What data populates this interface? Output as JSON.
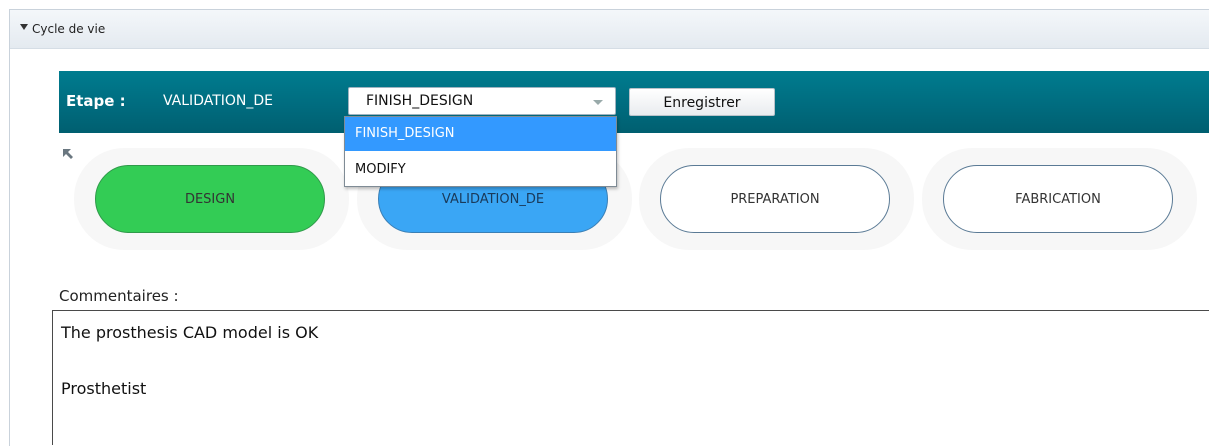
{
  "panel": {
    "title": "Cycle de vie"
  },
  "stepbar": {
    "label": "Etape :",
    "current": "VALIDATION_DE",
    "select_value": "FINISH_DESIGN",
    "options": [
      "FINISH_DESIGN",
      "MODIFY"
    ],
    "save_label": "Enregistrer"
  },
  "steps": [
    {
      "label": "DESIGN",
      "state": "done",
      "color": "#33cc55"
    },
    {
      "label": "VALIDATION_DE",
      "state": "current",
      "color": "#3aa6f5"
    },
    {
      "label": "PREPARATION",
      "state": "pending",
      "color": "#ffffff"
    },
    {
      "label": "FABRICATION",
      "state": "pending",
      "color": "#ffffff"
    }
  ],
  "comments": {
    "label": "Commentaires :",
    "text": "The prosthesis CAD model is OK\n\nProsthetist"
  },
  "colors": {
    "stepbar": "#006c7f",
    "highlight": "#3399ff"
  }
}
